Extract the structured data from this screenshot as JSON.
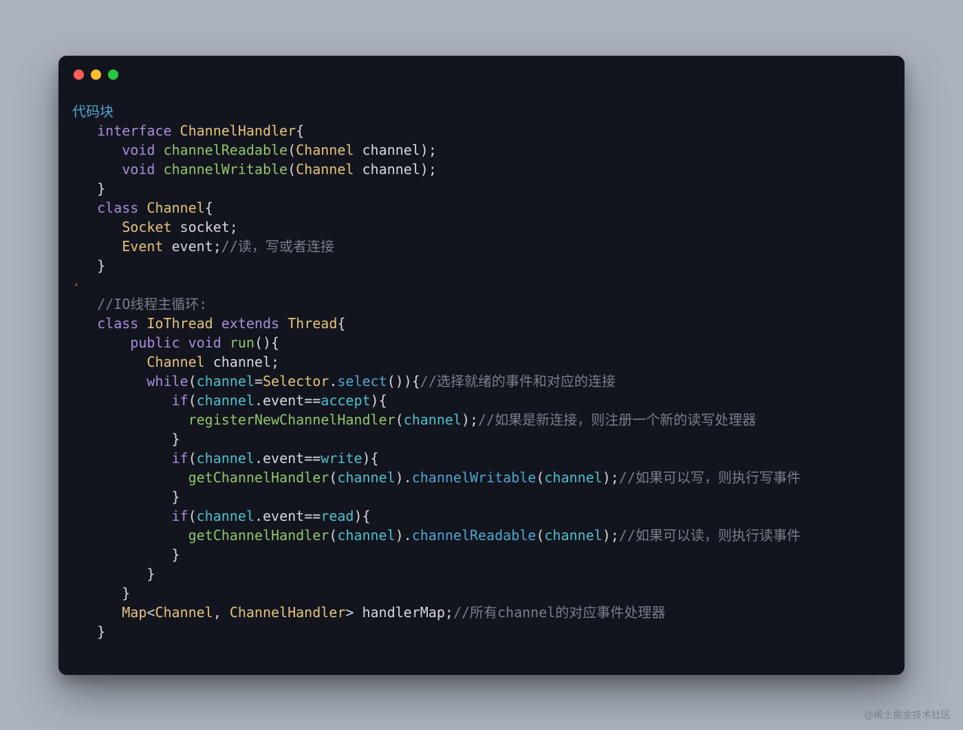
{
  "title": "代码块",
  "watermark": "@稀土掘金技术社区",
  "lines": {
    "l1_kw": "interface",
    "l1_cls": "ChannelHandler",
    "l1_brace": "{",
    "l2_void": "void",
    "l2_fn": "channelReadable",
    "l2_lp": "(",
    "l2_type": "Channel",
    "l2_arg": "channel",
    "l2_rp": ");",
    "l3_void": "void",
    "l3_fn": "channelWritable",
    "l3_lp": "(",
    "l3_type": "Channel",
    "l3_arg": "channel",
    "l3_rp": ");",
    "l4_rbrace": "}",
    "l5_kw": "class",
    "l5_cls": "Channel",
    "l5_brace": "{",
    "l6_type": "Socket",
    "l6_id": "socket;",
    "l7_type": "Event",
    "l7_id": "event;",
    "l7_cmt": "//读，写或者连接",
    "l8_rbrace": "}",
    "l8b_dot": "·",
    "l9_cmt": "//IO线程主循环:",
    "l10_kw": "class",
    "l10_cls": "IoThread",
    "l10_ext": "extends",
    "l10_sup": "Thread",
    "l10_brace": "{",
    "l11_pub": "public",
    "l11_void": "void",
    "l11_fn": "run",
    "l11_paren": "(){",
    "l12_type": "Channel",
    "l12_id": "channel;",
    "l13_while": "while",
    "l13_lp": "(",
    "l13_chan": "channel",
    "l13_eq": "=",
    "l13_sel": "Selector",
    "l13_dot": ".",
    "l13_m": "select",
    "l13_rp": "()){",
    "l13_cmt": "//选择就绪的事件和对应的连接",
    "l14_if": "if",
    "l14_lp": "(",
    "l14_chan": "channel",
    "l14_dot": ".",
    "l14_ev": "event",
    "l14_eq": "==",
    "l14_accept": "accept",
    "l14_rp": "){",
    "l15_fn": "registerNewChannelHandler",
    "l15_lp": "(",
    "l15_arg": "channel",
    "l15_rp": ");",
    "l15_cmt": "//如果是新连接，则注册一个新的读写处理器",
    "l16_rbrace": "}",
    "l17_if": "if",
    "l17_lp": "(",
    "l17_chan": "channel",
    "l17_dot": ".",
    "l17_ev": "event",
    "l17_eq": "==",
    "l17_write": "write",
    "l17_rp": "){",
    "l18_fn": "getChannelHandler",
    "l18_lp": "(",
    "l18_arg": "channel",
    "l18_rp": ").",
    "l18_m": "channelWritable",
    "l18_lp2": "(",
    "l18_arg2": "channel",
    "l18_rp2": ");",
    "l18_cmt": "//如果可以写，则执行写事件",
    "l19_rbrace": "}",
    "l20_if": "if",
    "l20_lp": "(",
    "l20_chan": "channel",
    "l20_dot": ".",
    "l20_ev": "event",
    "l20_eq": "==",
    "l20_read": "read",
    "l20_rp": "){",
    "l21_fn": "getChannelHandler",
    "l21_lp": "(",
    "l21_arg": "channel",
    "l21_rp": ").",
    "l21_m": "channelReadable",
    "l21_lp2": "(",
    "l21_arg2": "channel",
    "l21_rp2": ");",
    "l21_cmt": "//如果可以读，则执行读事件",
    "l22_rbrace": "}",
    "l23_rbrace": "}",
    "l24_rbrace": "}",
    "l25_map": "Map",
    "l25_lt": "<",
    "l25_t1": "Channel",
    "l25_comma": ", ",
    "l25_t2": "ChannelHandler",
    "l25_gt": ">",
    "l25_id": " handlerMap;",
    "l25_cmt": "//所有channel的对应事件处理器",
    "l26_rbrace": "}"
  }
}
